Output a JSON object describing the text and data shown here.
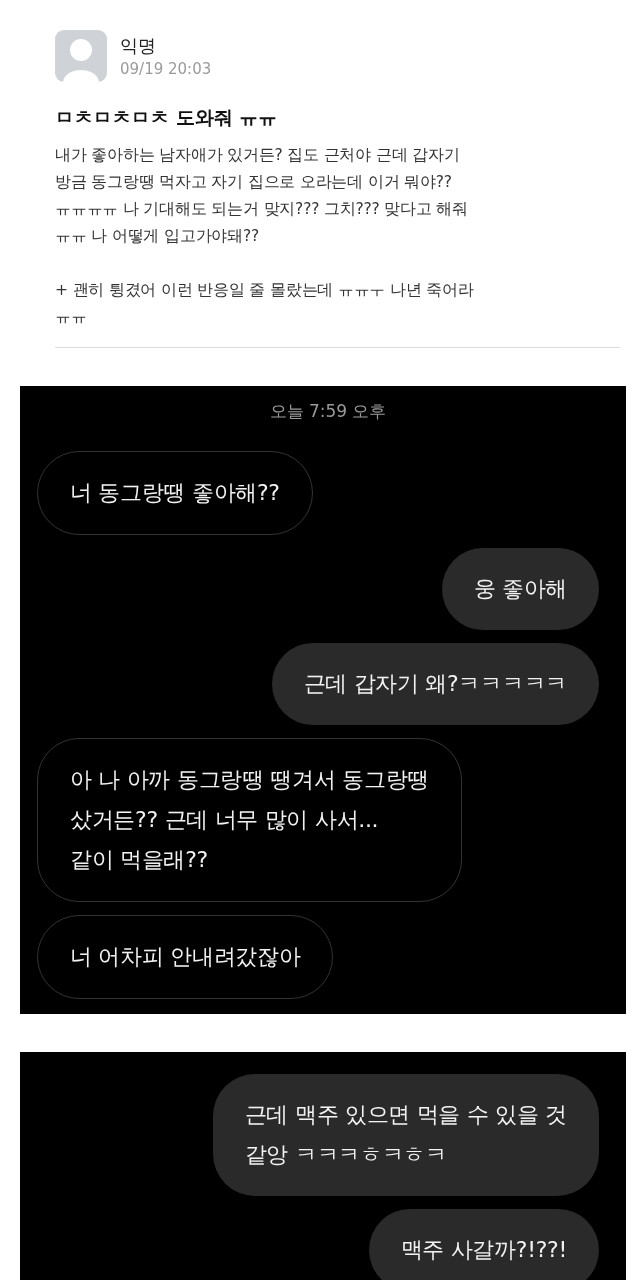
{
  "post": {
    "author": "익명",
    "time": "09/19 20:03",
    "title": "ㅁㅊㅁㅊㅁㅊ 도와줘 ㅠㅠ",
    "body": "내가 좋아하는 남자애가 있거든? 집도 근처야 근데 갑자기\n방금 동그랑땡 먹자고 자기 집으로 오라는데 이거 뭐야??\nㅠㅠㅠㅠ 나 기대해도 되는거 맞지??? 그치??? 맞다고 해줘\nㅠㅠ 나 어떻게 입고가야돼??\n\n+ 괜히 튕겼어 이런 반응일 줄 몰랐는데 ㅠㅠㅜ 나년 죽어라\nㅠㅠ"
  },
  "chat_screenshots": [
    {
      "timestamp": "오늘 7:59 오후",
      "messages": [
        {
          "kind": "received",
          "text": "너 동그랑땡 좋아해??"
        },
        {
          "kind": "sent",
          "text": "웅 좋아해"
        },
        {
          "kind": "sent",
          "text": "근데 갑자기 왜?ㅋㅋㅋㅋㅋ"
        },
        {
          "kind": "received",
          "text": "아 나 아까 동그랑땡 땡겨서 동그랑땡\n샀거든?? 근데 너무 많이 사서...\n같이 먹을래??"
        },
        {
          "kind": "received",
          "text": "너 어차피 안내려갔잖아"
        }
      ]
    },
    {
      "messages": [
        {
          "kind": "sent",
          "text": "근데 맥주 있으면 먹을 수 있을 것\n같앙 ㅋㅋㅋㅎㅋㅎㅋ"
        },
        {
          "kind": "sent",
          "text": "맥주 사갈까?!??!"
        }
      ]
    }
  ]
}
